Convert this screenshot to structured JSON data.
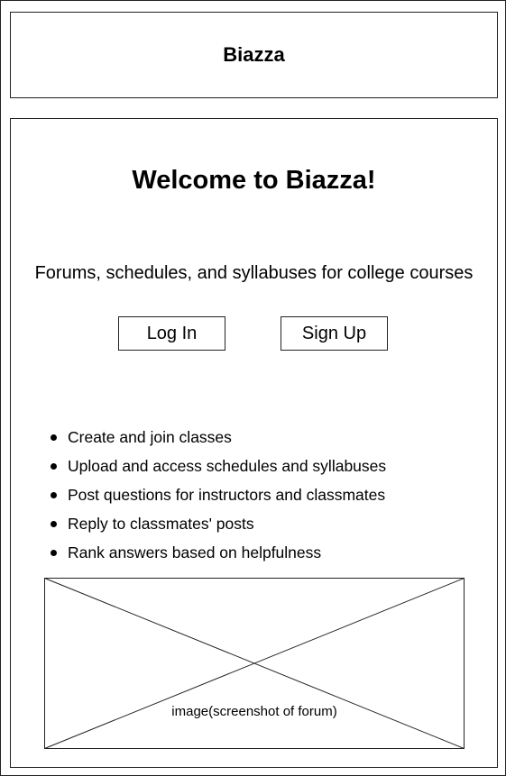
{
  "header": {
    "brand": "Biazza"
  },
  "main": {
    "welcome": "Welcome to Biazza!",
    "tagline": "Forums, schedules, and syllabuses for college courses",
    "buttons": {
      "login": "Log In",
      "signup": "Sign Up"
    },
    "features": [
      "Create and join classes",
      "Upload and access schedules and syllabuses",
      "Post questions for instructors and classmates",
      "Reply to classmates' posts",
      "Rank answers based on helpfulness"
    ],
    "image_placeholder": {
      "caption": "image(screenshot of forum)"
    }
  }
}
